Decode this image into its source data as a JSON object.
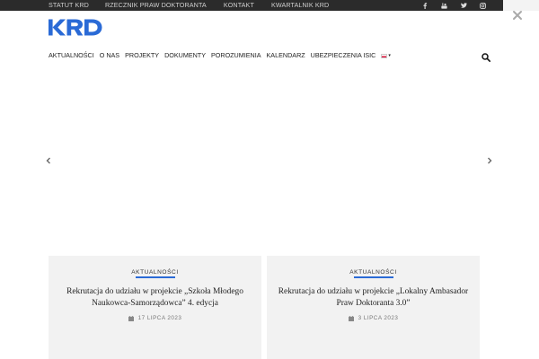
{
  "topbar": {
    "links": [
      "Statut KRD",
      "Rzecznik Praw Doktoranta",
      "Kontakt",
      "Kwartalnik KRD"
    ],
    "social_icons": [
      "facebook-icon",
      "youtube-icon",
      "twitter-icon",
      "instagram-icon"
    ]
  },
  "logo": {
    "text": "KRD",
    "color": "#2a6ad6"
  },
  "nav": {
    "items": [
      "Aktualności",
      "O nas",
      "Projekty",
      "Dokumenty",
      "Porozumienia",
      "Kalendarz",
      "Ubezpieczenia ISIC"
    ],
    "language_icon": "poland-flag-icon",
    "search_icon": "search-icon"
  },
  "slider": {
    "prev_icon": "chevron-left-icon",
    "next_icon": "chevron-right-icon"
  },
  "cards": [
    {
      "category": "Aktualności",
      "title": "Rekrutacja do udziału w projekcie „Szkoła Młodego Naukowca-Samorządowca” 4. edycja",
      "date": "17 lipca 2023"
    },
    {
      "category": "Aktualności",
      "title": "Rekrutacja do udziału w projekcie „Lokalny Ambasador Praw Doktoranta 3.0”",
      "date": "3 lipca 2023"
    }
  ],
  "colors": {
    "accent": "#2a6ad6",
    "topbar": "#2b2b2b",
    "card_bg": "#f2f2f2"
  }
}
